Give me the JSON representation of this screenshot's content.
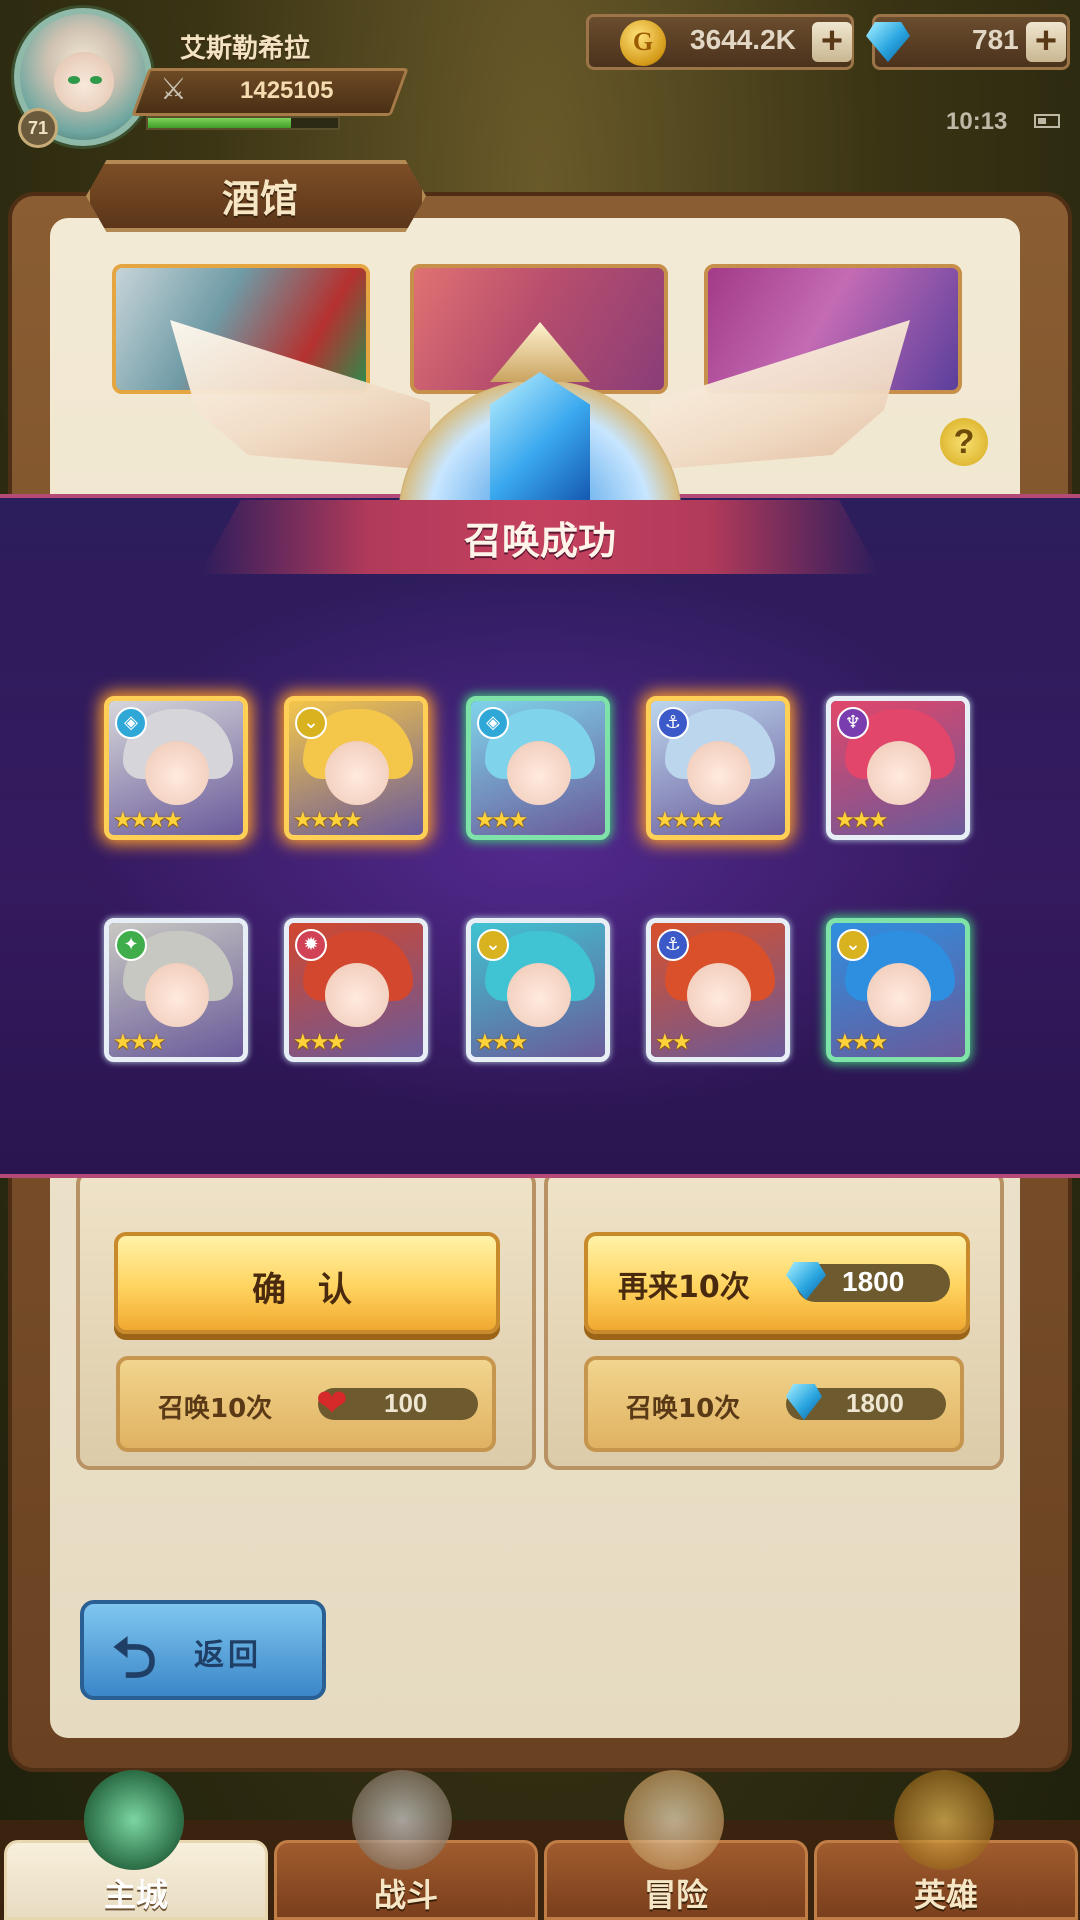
{
  "player": {
    "name": "艾斯勒希拉",
    "level": "71",
    "power": "1425105",
    "exp_fraction": 0.75
  },
  "resources": {
    "gold": "3644.2K",
    "gems": "781",
    "gold_icon": "gold-coin-icon",
    "gem_icon": "diamond-icon",
    "plus_glyph": "+"
  },
  "status": {
    "time": "10:13"
  },
  "tavern": {
    "title": "酒馆",
    "help_glyph": "?"
  },
  "result": {
    "title": "召唤成功",
    "heroes": [
      {
        "rarity": "gold",
        "class_icon": "shield-class-icon",
        "class_glyph": "◈",
        "class_color": "#2fa8d8",
        "stars": 4,
        "hair": "#d6d6da"
      },
      {
        "rarity": "gold",
        "class_icon": "chevron-class-icon",
        "class_glyph": "⌄",
        "class_color": "#d8b21f",
        "stars": 4,
        "hair": "#f4c64a"
      },
      {
        "rarity": "green",
        "class_icon": "shield-class-icon",
        "class_glyph": "◈",
        "class_color": "#2fa8d8",
        "stars": 3,
        "hair": "#7fd3ea"
      },
      {
        "rarity": "gold",
        "class_icon": "anchor-class-icon",
        "class_glyph": "⚓",
        "class_color": "#3b59c8",
        "stars": 4,
        "hair": "#bcd6ee"
      },
      {
        "rarity": "white",
        "class_icon": "demon-class-icon",
        "class_glyph": "♆",
        "class_color": "#7a3db0",
        "stars": 3,
        "hair": "#e2466a"
      },
      {
        "rarity": "white",
        "class_icon": "beast-class-icon",
        "class_glyph": "✦",
        "class_color": "#3fae4a",
        "stars": 3,
        "hair": "#c8c8c2"
      },
      {
        "rarity": "white",
        "class_icon": "flame-class-icon",
        "class_glyph": "✹",
        "class_color": "#d24256",
        "stars": 3,
        "hair": "#d2472e"
      },
      {
        "rarity": "white",
        "class_icon": "chevron-class-icon",
        "class_glyph": "⌄",
        "class_color": "#d8b21f",
        "stars": 3,
        "hair": "#40c3d2"
      },
      {
        "rarity": "white",
        "class_icon": "anchor-class-icon",
        "class_glyph": "⚓",
        "class_color": "#3b59c8",
        "stars": 2,
        "hair": "#d9502a"
      },
      {
        "rarity": "green",
        "class_icon": "chevron-class-icon",
        "class_glyph": "⌄",
        "class_color": "#d8b21f",
        "stars": 3,
        "hair": "#2e8fe0"
      }
    ]
  },
  "actions": {
    "confirm_label": "确 认",
    "again_label": "再来10次",
    "again_cost": "1800",
    "summon_left_label": "召唤10次",
    "summon_left_cost": "100",
    "summon_right_label": "召唤10次",
    "summon_right_cost": "1800",
    "back_label": "返回",
    "back_glyph": "⮌"
  },
  "nav": {
    "home": "主城",
    "battle": "战斗",
    "adventure": "冒险",
    "heroes": "英雄"
  }
}
